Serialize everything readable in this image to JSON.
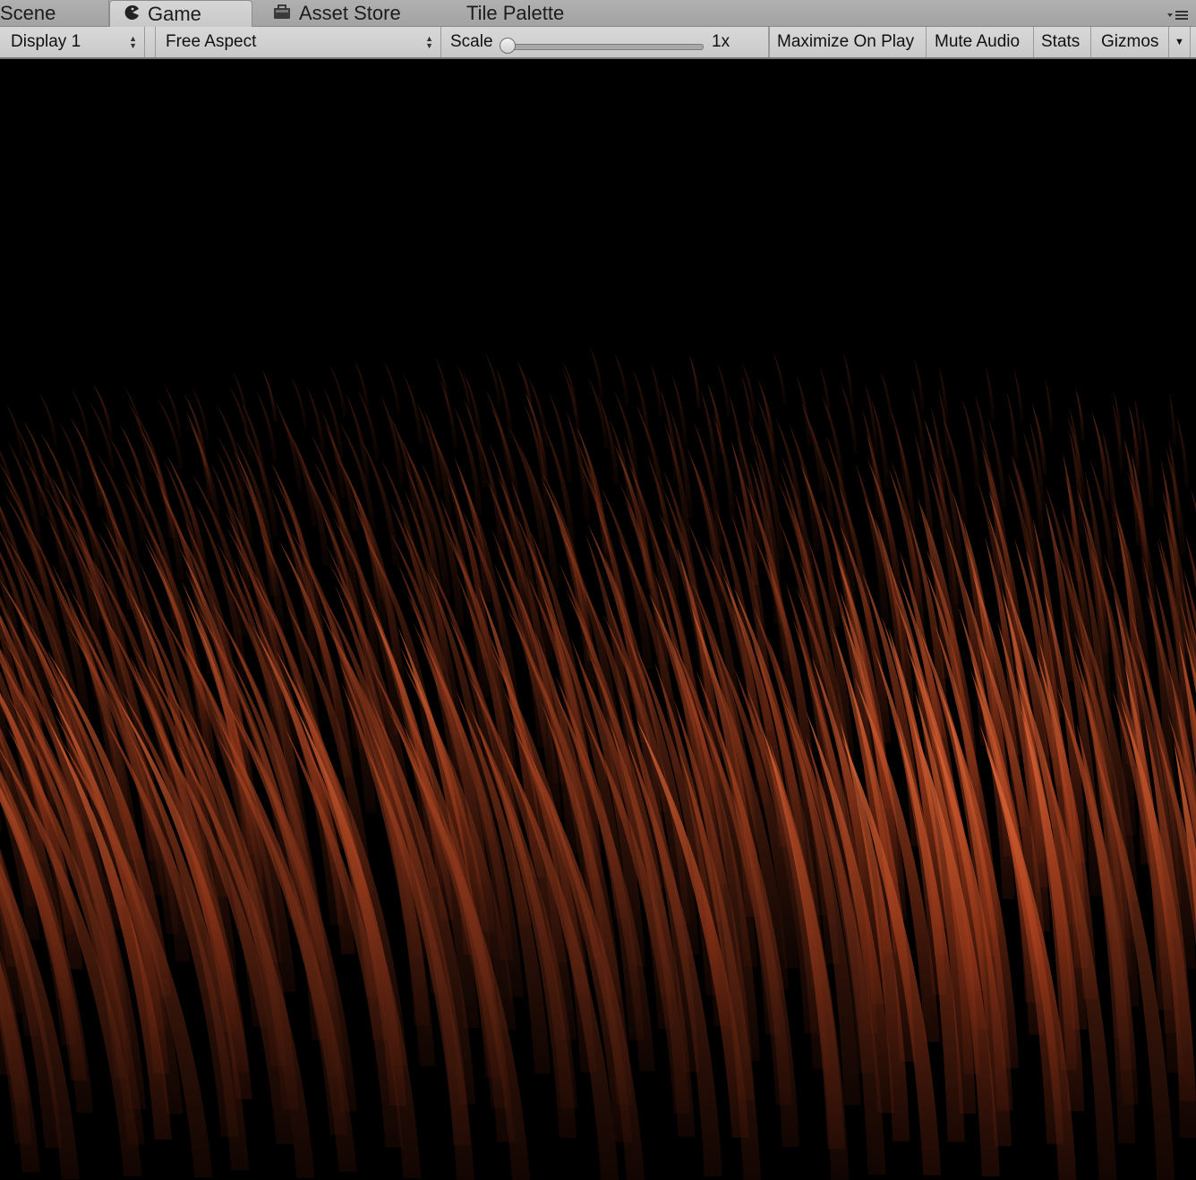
{
  "tabs": [
    {
      "label": "Scene",
      "icon": "none",
      "active": false
    },
    {
      "label": "Game",
      "icon": "pacman-icon",
      "active": true
    },
    {
      "label": "Asset Store",
      "icon": "store-bag-icon",
      "active": false
    },
    {
      "label": "Tile Palette",
      "icon": "none",
      "active": false
    }
  ],
  "toolbar": {
    "display": "Display 1",
    "aspect": "Free Aspect",
    "scale_label": "Scale",
    "scale_value": "1x",
    "scale_level": 0,
    "maximize_on_play": "Maximize On Play",
    "mute_audio": "Mute Audio",
    "stats": "Stats",
    "gizmos": "Gizmos"
  },
  "viewport": {
    "background": "#000000",
    "blade_color": "#b8461f",
    "blade_highlight": "#e06a3a"
  }
}
